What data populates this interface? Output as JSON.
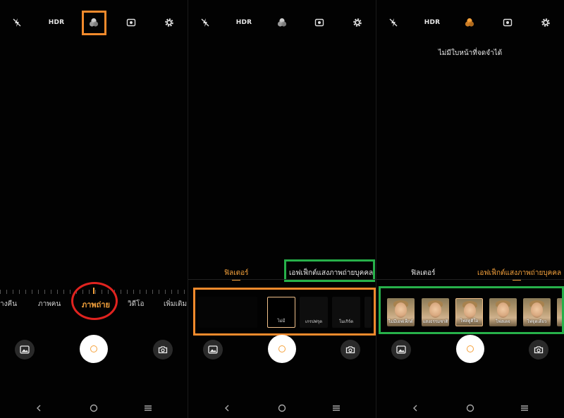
{
  "top_icons": [
    "flash-off-icon",
    "hdr-label",
    "filter-icon",
    "portrait-effect-icon",
    "settings-icon"
  ],
  "hdr_label": "HDR",
  "panel1": {
    "modes": [
      "างคืน",
      "ภาพคน",
      "ภาพถ่าย",
      "วิดีโอ",
      "เพิ่มเติม"
    ],
    "active_mode": "ภาพถ่าย"
  },
  "panel2": {
    "tabs": [
      "ฟิลเตอร์",
      "เอฟเฟ็กต์แสงภาพถ่ายบุคคล"
    ],
    "active_tab": "ฟิลเตอร์",
    "filters": [
      "ไม่มี",
      "เกรปฟรุต",
      "โมเกิร์ต"
    ],
    "selected_filter": "ไม่มี"
  },
  "panel3": {
    "message": "ไม่มีใบหน้าที่จดจำได้",
    "tabs": [
      "ฟิลเตอร์",
      "เอฟเฟ็กต์แสงภาพถ่ายบุคคล"
    ],
    "active_tab": "เอฟเฟ็กต์แสงภาพถ่ายบุคคล",
    "effects": [
      "ไม่มีเอฟเฟ็กต์",
      "แสงธรรมชาติ",
      "ไฟสตูดิโอ",
      "ไฟสเตจ",
      "ไฟจุดเดียว"
    ]
  },
  "colors": {
    "accent": "#f5a23c",
    "highlight_orange": "#f18a2c",
    "highlight_green": "#27b04a",
    "highlight_red": "#e0231f"
  },
  "bottom_buttons": [
    "gallery-icon",
    "shutter-button",
    "switch-camera-icon"
  ],
  "nav_buttons": [
    "back-icon",
    "home-icon",
    "menu-icon"
  ]
}
